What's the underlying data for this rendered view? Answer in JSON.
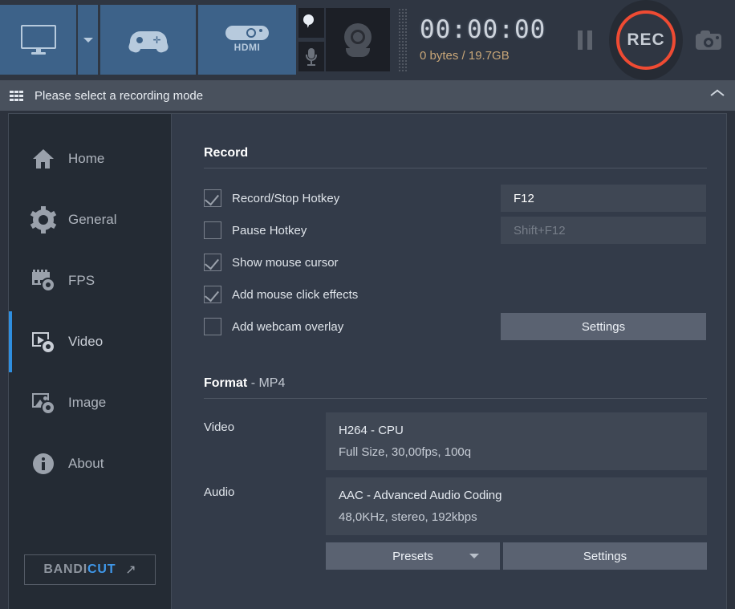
{
  "toolbar": {
    "modes": [
      {
        "name": "screen-recording-mode",
        "icon": "monitor-icon",
        "label": "Screen Recording Mode"
      },
      {
        "name": "screen-mode-dropdown",
        "icon": "chevron-down-icon",
        "label": "Screen Mode Options"
      },
      {
        "name": "game-recording-mode",
        "icon": "gamepad-icon",
        "label": "Game Recording Mode"
      },
      {
        "name": "device-recording-mode",
        "icon": "hdmi-icon",
        "label": "HDMI",
        "caption": "HDMI"
      }
    ],
    "capture": {
      "cursor_icon": "mouse-cursor-icon",
      "mic_icon": "microphone-icon",
      "webcam_icon": "webcam-icon",
      "grip_icon": "drag-grip-icon"
    },
    "timer": "00:00:00",
    "size_info": "0 bytes / 19.7GB",
    "pause_label": "Pause",
    "rec_label": "REC",
    "snapshot_label": "Snapshot",
    "rec_color": "#ef4b33",
    "size_color": "#c8a678",
    "mode_color": "#3d6289"
  },
  "statusbar": {
    "grid_icon": "grid-apps-icon",
    "message": "Please select a recording mode",
    "collapse_icon": "chevron-up-icon"
  },
  "sidebar": {
    "items": [
      {
        "label": "Home",
        "icon": "home-icon",
        "active": false
      },
      {
        "label": "General",
        "icon": "gear-icon",
        "active": false
      },
      {
        "label": "FPS",
        "icon": "fps-filmstrip-icon",
        "active": false
      },
      {
        "label": "Video",
        "icon": "video-gear-icon",
        "active": true
      },
      {
        "label": "Image",
        "icon": "image-gear-icon",
        "active": false
      },
      {
        "label": "About",
        "icon": "info-icon",
        "active": false
      }
    ],
    "promo": {
      "brand_part1": "BANDI",
      "brand_part2": "CUT",
      "arrow": "↗",
      "accent_color": "#3f97e8"
    },
    "active_accent": "#2f8fe0"
  },
  "record_section": {
    "title": "Record",
    "options": [
      {
        "label": "Record/Stop Hotkey",
        "checked": true,
        "name": "record-stop-hotkey"
      },
      {
        "label": "Pause Hotkey",
        "checked": false,
        "name": "pause-hotkey"
      },
      {
        "label": "Show mouse cursor",
        "checked": true,
        "name": "show-mouse-cursor"
      },
      {
        "label": "Add mouse click effects",
        "checked": true,
        "name": "add-mouse-click-effects"
      },
      {
        "label": "Add webcam overlay",
        "checked": false,
        "name": "add-webcam-overlay"
      }
    ],
    "record_hotkey_value": "F12",
    "pause_hotkey_value": "Shift+F12",
    "webcam_settings_label": "Settings"
  },
  "format_section": {
    "title": "Format",
    "subtitle": "- MP4",
    "video_label": "Video",
    "video_codec": "H264 - CPU",
    "video_details": "Full Size, 30,00fps, 100q",
    "audio_label": "Audio",
    "audio_codec": "AAC - Advanced Audio Coding",
    "audio_details": "48,0KHz, stereo, 192kbps",
    "presets_label": "Presets",
    "settings_label": "Settings"
  }
}
